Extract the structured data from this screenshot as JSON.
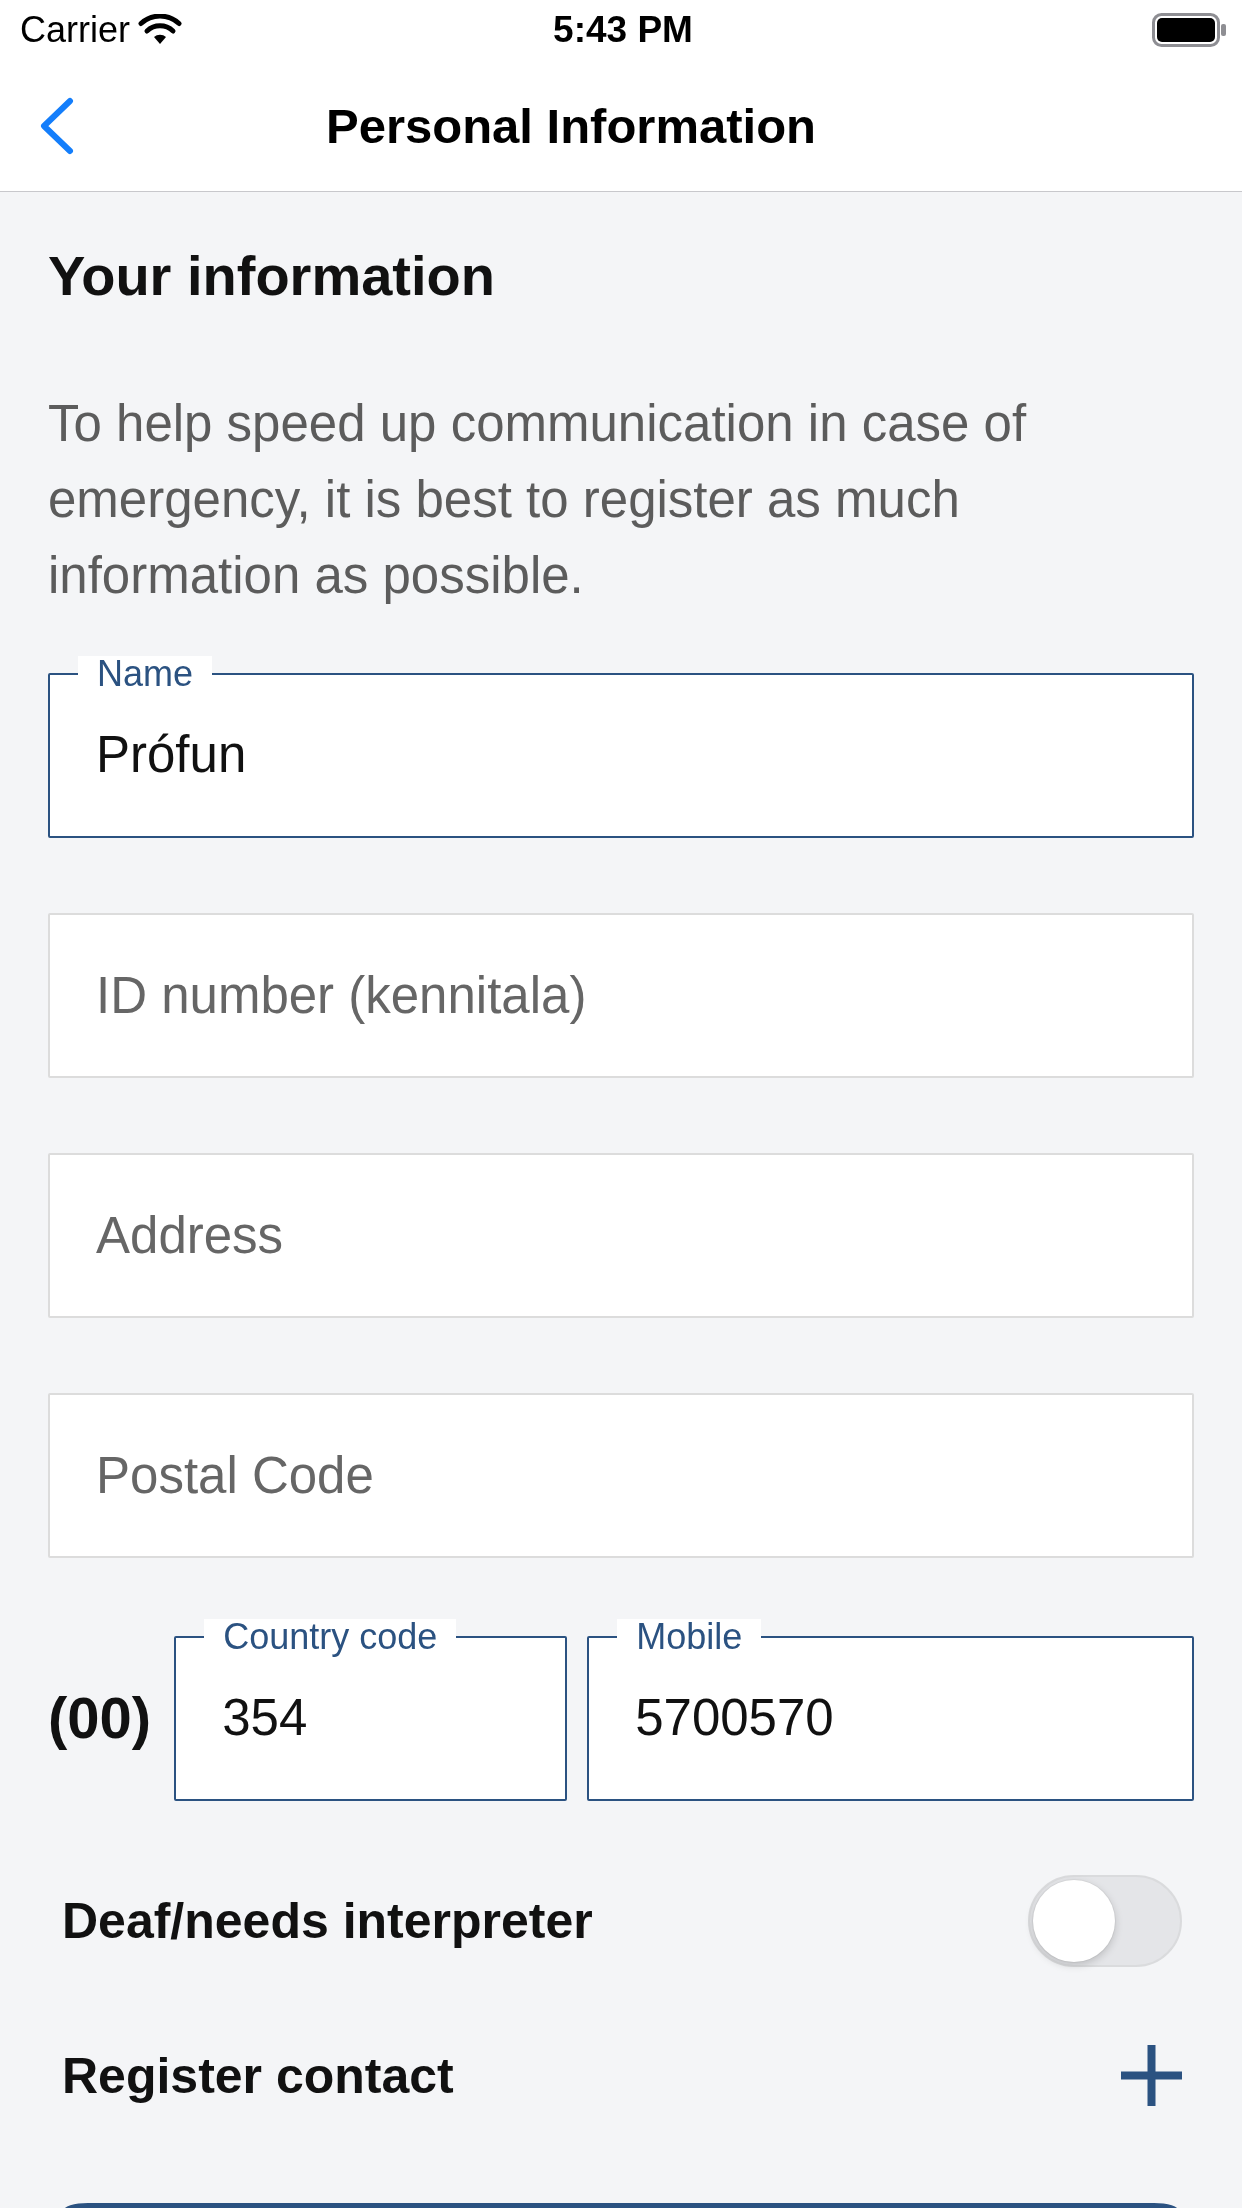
{
  "status_bar": {
    "carrier": "Carrier",
    "time": "5:43 PM"
  },
  "nav_bar": {
    "title": "Personal Information"
  },
  "section": {
    "heading": "Your information",
    "description": "To help speed up communication in case of emergency, it is best to register as much information as possible."
  },
  "fields": [
    {
      "label": "Name",
      "value": "Prófun"
    },
    {
      "placeholder": "ID number (kennitala)"
    },
    {
      "placeholder": "Address"
    },
    {
      "placeholder": "Postal Code"
    }
  ],
  "phone": {
    "prefix": "(00)",
    "fields": [
      {
        "label": "Country code",
        "value": "354"
      },
      {
        "label": "Mobile",
        "value": "5700570"
      }
    ]
  },
  "settings": [
    {
      "kind": "toggle",
      "label": "Deaf/needs interpreter",
      "on": false
    },
    {
      "kind": "add",
      "label": "Register contact"
    }
  ]
}
